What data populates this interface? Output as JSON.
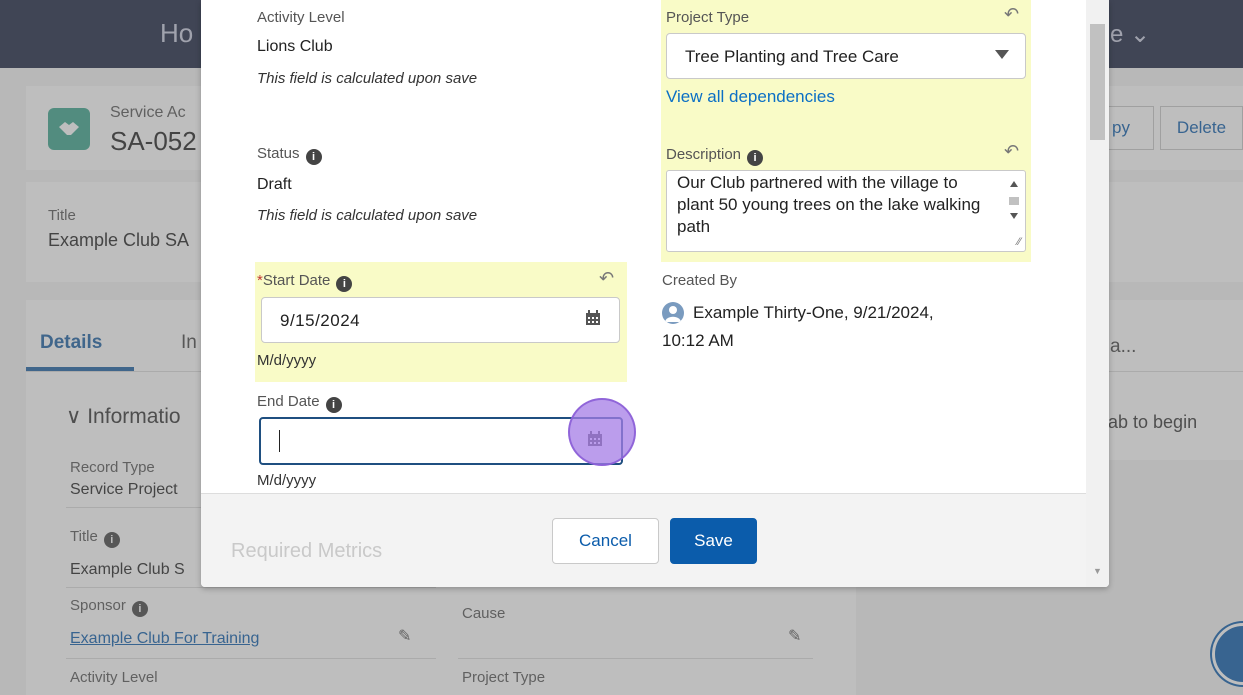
{
  "background": {
    "nav_left": "Ho",
    "nav_right": "e ⌄",
    "object_label": "Service Ac",
    "record_name": "SA-052",
    "buttons": [
      "py",
      "Delete"
    ],
    "highlight_label": "Title",
    "highlight_value": "Example Club SA",
    "tabs": {
      "details": "Details",
      "other": "In",
      "right_fragment": "a..."
    },
    "section_title": "Informatio",
    "right_hint": "ab to begin",
    "fields": {
      "record_type_label": "Record Type",
      "record_type_value": "Service Project",
      "title_label": "Title",
      "title_value": "Example Club S",
      "sponsor_label": "Sponsor",
      "sponsor_value": "Example Club For Training",
      "cause_label": "Cause",
      "activity_level_label": "Activity Level",
      "project_type_label": "Project Type"
    }
  },
  "modal": {
    "left": {
      "activity_level_label": "Activity Level",
      "activity_level_value": "Lions Club",
      "activity_level_note": "This field is calculated upon save",
      "status_label": "Status",
      "status_value": "Draft",
      "status_note": "This field is calculated upon save",
      "start_date_required": "*",
      "start_date_label": "Start Date",
      "start_date_value": "9/15/2024",
      "start_date_format": "M/d/yyyy",
      "end_date_label": "End Date",
      "end_date_value": "",
      "end_date_format": "M/d/yyyy"
    },
    "right": {
      "project_type_label": "Project Type",
      "project_type_value": "Tree Planting and Tree Care",
      "dependencies_link": "View all dependencies",
      "description_label": "Description",
      "description_value": "Our Club partnered with the village to plant 50 young trees on the lake walking path",
      "created_by_label": "Created By",
      "created_by_value": "Example Thirty-One, 9/21/2024,",
      "created_by_time": "10:12 AM"
    },
    "footer": {
      "ghost_text": "Required Metrics",
      "cancel_label": "Cancel",
      "save_label": "Save"
    }
  },
  "colors": {
    "brand_blue": "#0b5cab",
    "highlight_yellow": "#f9fbc7",
    "focus_border": "#1f4f80",
    "click_marker": "#a47ce6"
  }
}
